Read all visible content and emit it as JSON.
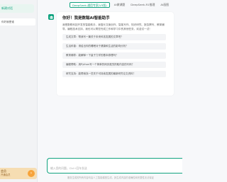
{
  "sidebar": {
    "new_chat_label": "新建对话",
    "history": [
      "你好我是谁"
    ],
    "bottom": {
      "title": "会员",
      "subtitle": "开通会员",
      "arrow_icon": "arrow-right-icon"
    }
  },
  "tabs": [
    {
      "label": "DeepSeek-通用专家(V3版)",
      "active": true
    },
    {
      "label": "AI做课题",
      "active": false
    },
    {
      "label": "DeepSeek-R1推理",
      "active": false
    },
    {
      "label": "AI画图",
      "active": false
    }
  ],
  "chat": {
    "title": "你好！我是数聪AI智能助手",
    "description": "我是数聪科技开发的智能助手，我擅长文案创作、智能写作、知识研究、报告撰写、教育辅导、编程技术支持，我也可以帮您完成工作和学习中的其他任务，欢迎试一试！",
    "suggestions": [
      "生成文章：帮我写一篇关于未来科技发展的文章吧？",
      "生活科普：请给出你的睡眠对于健康和生活的影响分析？",
      "教育辅导：能解释一下量子力学的基本原理吗？",
      "编程帮助：用Python写一个简单的网页爬虫抓取内容的代码？",
      "研究支持：能帮我找一些关于可持续发展的最新研究论文资料？"
    ]
  },
  "input": {
    "placeholder": "输入您的问题，Ctrl+回车发送",
    "value": ""
  },
  "footer": "服务生成的所有内容均由人工智能模型生成，其生成内容的准确性和完整性无法保证"
}
